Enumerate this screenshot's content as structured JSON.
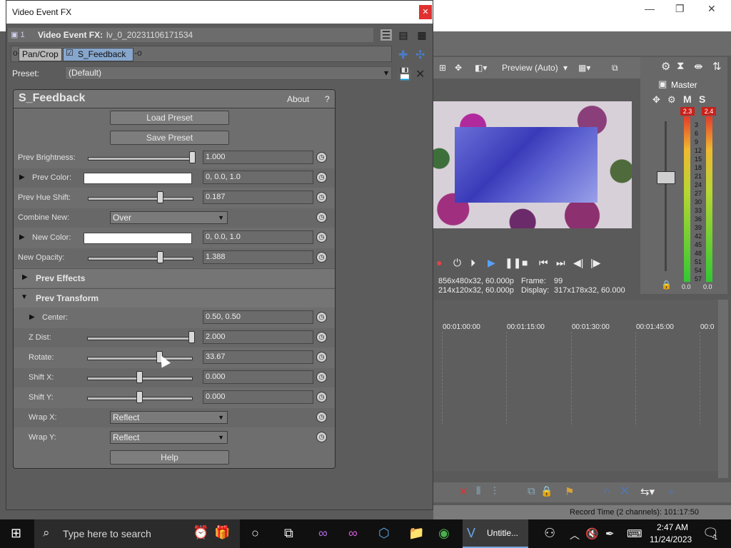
{
  "window_title": "Video Event FX",
  "fx_header": {
    "index": "1",
    "label": "Video Event FX:",
    "event_name": "lv_0_20231106171534"
  },
  "fx_chain": [
    "Pan/Crop",
    "S_Feedback"
  ],
  "preset": {
    "label": "Preset:",
    "value": "(Default)"
  },
  "plugin": {
    "name": "S_Feedback",
    "about": "About",
    "help_q": "?",
    "load_preset": "Load Preset",
    "save_preset": "Save Preset",
    "help_button": "Help"
  },
  "params": {
    "prev_brightness": {
      "label": "Prev Brightness:",
      "value": "1.000",
      "level": 0.99
    },
    "prev_color": {
      "label": "Prev Color:",
      "value": "0, 0.0, 1.0"
    },
    "prev_hue_shift": {
      "label": "Prev Hue Shift:",
      "value": "0.187",
      "level": 0.69
    },
    "combine_new": {
      "label": "Combine New:",
      "value": "Over"
    },
    "new_color": {
      "label": "New Color:",
      "value": "0, 0.0, 1.0"
    },
    "new_opacity": {
      "label": "New Opacity:",
      "value": "1.388",
      "level": 0.69
    },
    "center": {
      "label": "Center:",
      "value": "0.50, 0.50"
    },
    "z_dist": {
      "label": "Z Dist:",
      "value": "2.000",
      "level": 0.99
    },
    "rotate": {
      "label": "Rotate:",
      "value": "33.67",
      "level": 0.69
    },
    "shift_x": {
      "label": "Shift X:",
      "value": "0.000",
      "level": 0.5
    },
    "shift_y": {
      "label": "Shift Y:",
      "value": "0.000",
      "level": 0.5
    },
    "wrap_x": {
      "label": "Wrap X:",
      "value": "Reflect"
    },
    "wrap_y": {
      "label": "Wrap Y:",
      "value": "Reflect"
    }
  },
  "sections": {
    "prev_effects": "Prev Effects",
    "prev_transform": "Prev Transform"
  },
  "preview": {
    "quality": "Preview (Auto)",
    "project_info": "856x480x32, 60.000p",
    "preview_info": "214x120x32, 60.000p",
    "frame_label": "Frame:",
    "frame_value": "99",
    "display_label": "Display:",
    "display_value": "317x178x32, 60.000"
  },
  "mixer": {
    "title": "Master",
    "m": "M",
    "s": "S",
    "peak_left": "2.3",
    "peak_right": "2.4",
    "scale": [
      "3",
      "6",
      "9",
      "12",
      "15",
      "18",
      "21",
      "24",
      "27",
      "30",
      "33",
      "36",
      "39",
      "42",
      "45",
      "48",
      "51",
      "54",
      "57"
    ],
    "level_left": "0.0",
    "level_right": "0.0"
  },
  "timeline": {
    "ruler": [
      "00:01:00:00",
      "00:01:15:00",
      "00:01:30:00",
      "00:01:45:00",
      "00:0"
    ]
  },
  "status": {
    "record_time": "Record Time (2 channels): 101:17:50"
  },
  "taskbar": {
    "search_placeholder": "Type here to search",
    "active_app": "Untitle...",
    "time": "2:47 AM",
    "date": "11/24/2023",
    "notification_count": "1"
  }
}
